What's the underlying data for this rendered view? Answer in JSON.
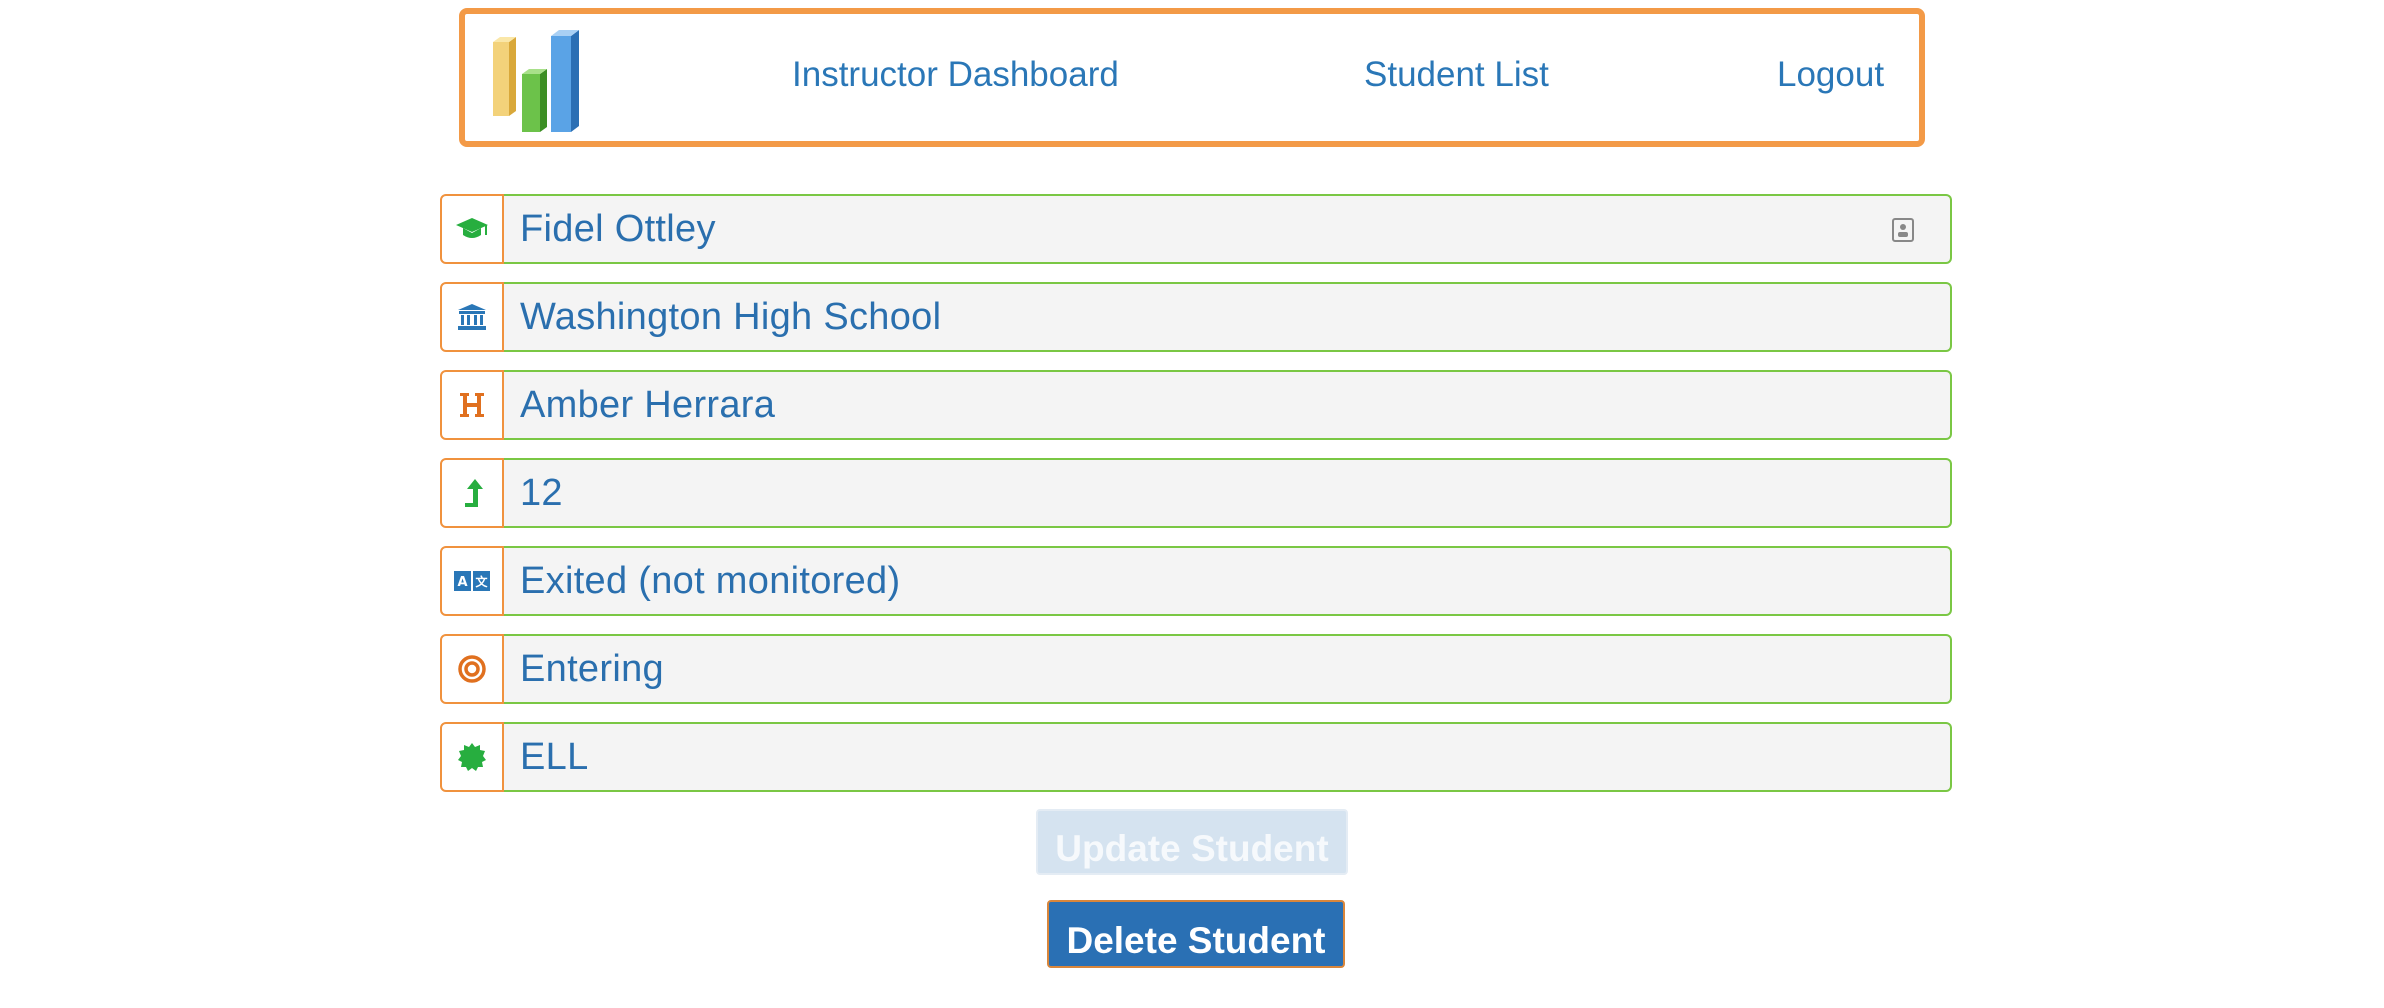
{
  "nav": {
    "dashboard_label": "Instructor Dashboard",
    "students_label": "Student List",
    "logout_label": "Logout"
  },
  "student": {
    "fields": [
      {
        "icon": "graduation-cap-icon",
        "icon_color": "#27ae3f",
        "value": "Fidel Ottley"
      },
      {
        "icon": "institution-icon",
        "icon_color": "#2a77b7",
        "value": "Washington High School"
      },
      {
        "icon": "header-h-icon",
        "icon_color": "#e0701f",
        "value": "Amber Herrara"
      },
      {
        "icon": "level-up-icon",
        "icon_color": "#27ae3f",
        "value": "12"
      },
      {
        "icon": "language-icon",
        "icon_color": "#2a77b7",
        "value": "Exited (not monitored)"
      },
      {
        "icon": "bullseye-icon",
        "icon_color": "#e0701f",
        "value": "Entering"
      },
      {
        "icon": "certificate-icon",
        "icon_color": "#27ae3f",
        "value": "ELL"
      }
    ]
  },
  "buttons": {
    "update_label": "Update Student",
    "delete_label": "Delete Student"
  },
  "colors": {
    "accent_orange": "#f39a47",
    "accent_green": "#7ac744",
    "link_blue": "#2a77b7",
    "button_blue": "#2a70b4",
    "disabled_blue": "#d5e3f0"
  }
}
